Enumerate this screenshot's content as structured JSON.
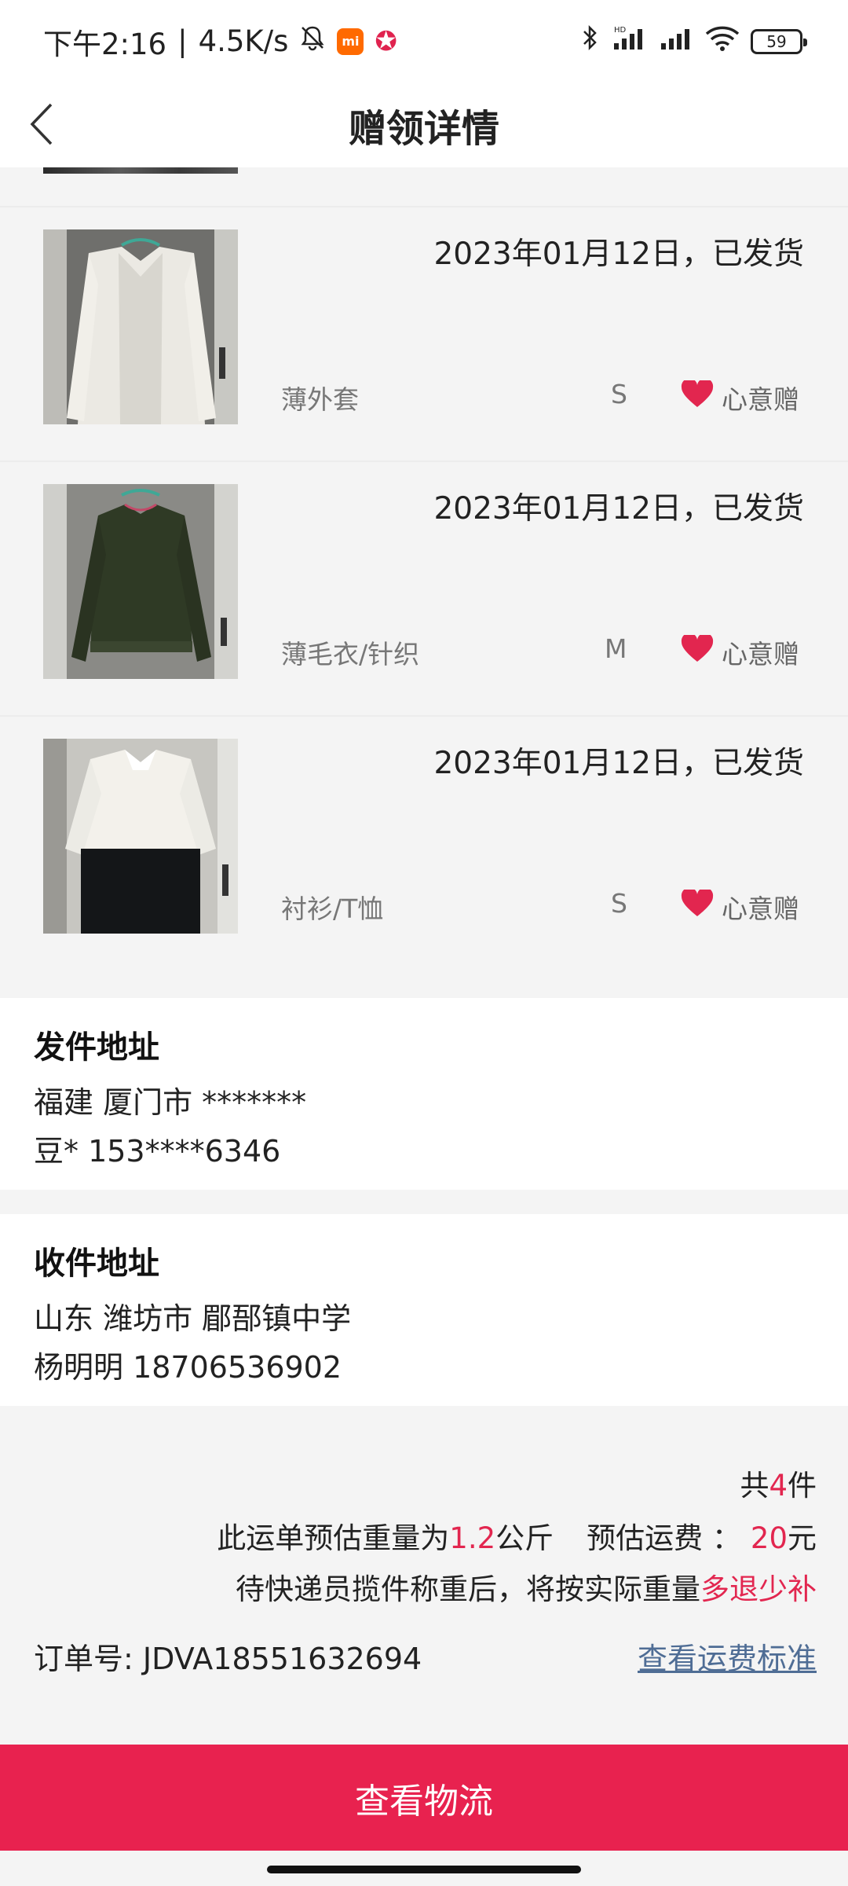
{
  "status_bar": {
    "time": "下午2:16",
    "speed": "4.5K/s",
    "battery": "59",
    "hd_label": "HD"
  },
  "header": {
    "title": "赠领详情"
  },
  "items": [
    {
      "date_status": "2023年01月12日，已发货",
      "category": "薄外套",
      "size": "S",
      "tag": "心意赠"
    },
    {
      "date_status": "2023年01月12日，已发货",
      "category": "薄毛衣/针织",
      "size": "M",
      "tag": "心意赠"
    },
    {
      "date_status": "2023年01月12日，已发货",
      "category": "衬衫/T恤",
      "size": "S",
      "tag": "心意赠"
    }
  ],
  "sender": {
    "title": "发件地址",
    "address": "福建 厦门市 *******",
    "contact": "豆* 153****6346"
  },
  "receiver": {
    "title": "收件地址",
    "address": "山东 潍坊市 郿郚镇中学",
    "contact": "杨明明 18706536902"
  },
  "summary": {
    "count_prefix": "共",
    "count": "4",
    "count_suffix": "件",
    "weight_prefix": "此运单预估重量为",
    "weight": "1.2",
    "weight_unit": "公斤",
    "fee_label": "预估运费 ：",
    "fee": "20",
    "fee_unit": "元",
    "note_prefix": "待快递员揽件称重后，将按实际重量",
    "note_highlight": "多退少补",
    "order_label": "订单号:",
    "order_no": "JDVA18551632694",
    "fee_link": "查看运费标准"
  },
  "bottom_button": {
    "label": "查看物流"
  },
  "colors": {
    "accent": "#e8224f",
    "highlight": "#e2264f",
    "link": "#4f6d95"
  }
}
